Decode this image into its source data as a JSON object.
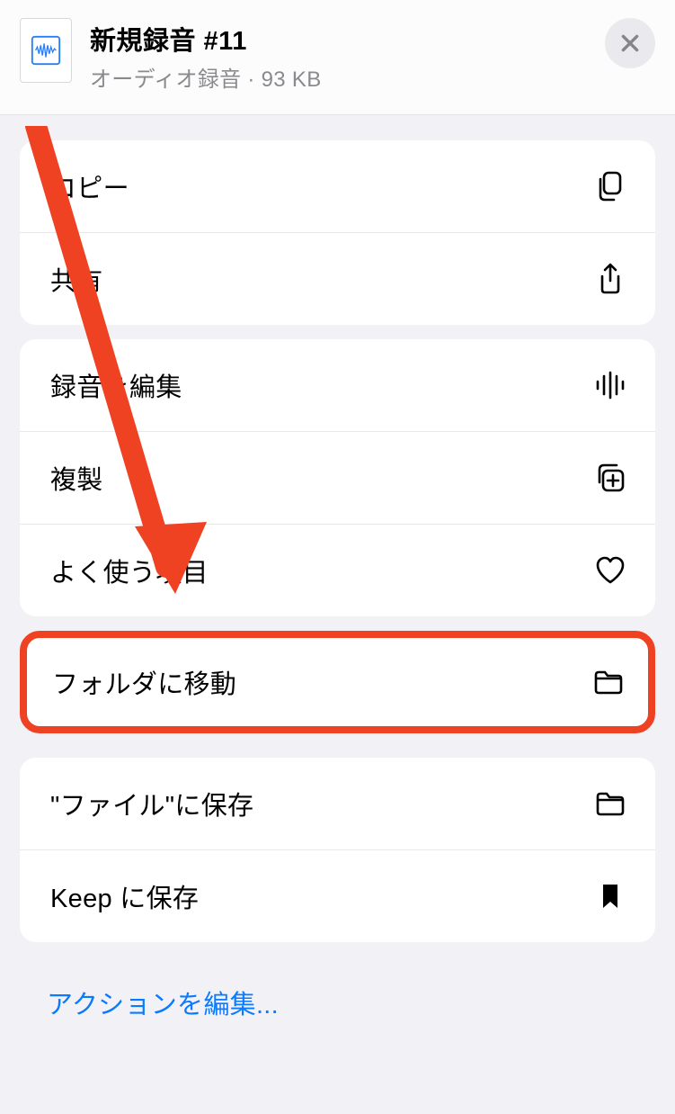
{
  "header": {
    "title": "新規録音 #11",
    "subtitle": "オーディオ録音 · 93 KB"
  },
  "groups": [
    {
      "items": [
        {
          "label": "コピー",
          "icon": "copy-icon",
          "name": "copy-row"
        },
        {
          "label": "共有",
          "icon": "share-icon",
          "name": "share-row"
        }
      ]
    },
    {
      "items": [
        {
          "label": "録音を編集",
          "icon": "waveform-icon",
          "name": "edit-recording-row"
        },
        {
          "label": "複製",
          "icon": "duplicate-icon",
          "name": "duplicate-row"
        },
        {
          "label": "よく使う項目",
          "icon": "heart-icon",
          "name": "favorite-row"
        }
      ]
    }
  ],
  "highlighted": {
    "label": "フォルダに移動",
    "icon": "folder-icon",
    "name": "move-to-folder-row"
  },
  "group3": {
    "items": [
      {
        "label": "\"ファイル\"に保存",
        "icon": "folder-icon",
        "name": "save-to-files-row"
      },
      {
        "label": "Keep に保存",
        "icon": "bookmark-icon",
        "name": "save-to-keep-row"
      }
    ]
  },
  "edit_actions_label": "アクションを編集...",
  "colors": {
    "highlight": "#ee4223",
    "link": "#0a7aff"
  }
}
